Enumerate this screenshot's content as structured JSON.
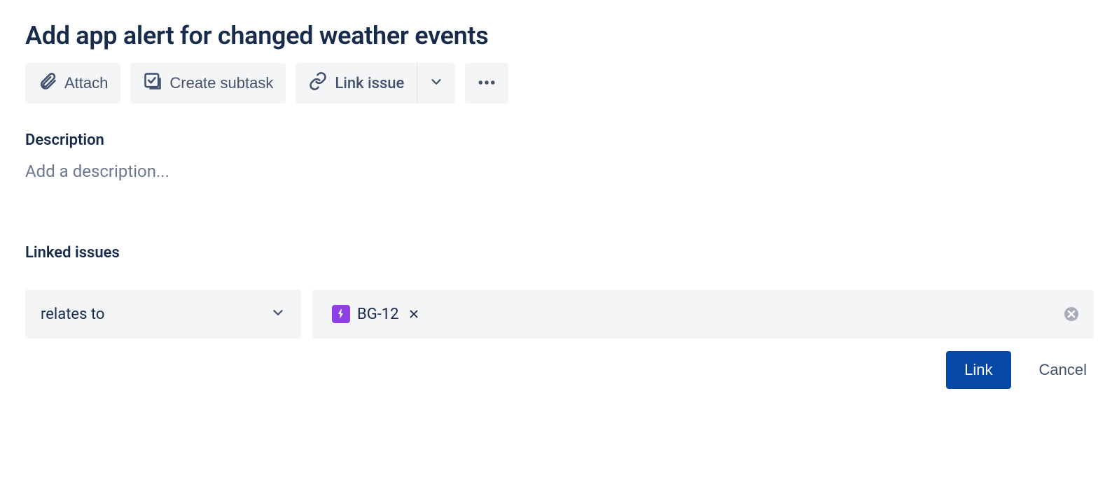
{
  "title": "Add app alert for changed weather events",
  "toolbar": {
    "attach_label": "Attach",
    "create_subtask_label": "Create subtask",
    "link_issue_label": "Link issue"
  },
  "sections": {
    "description_heading": "Description",
    "description_placeholder": "Add a description...",
    "linked_issues_heading": "Linked issues"
  },
  "link_form": {
    "relation_selected": "relates to",
    "selected_issue": {
      "key": "BG-12",
      "type_color": "#8F3FE6"
    },
    "link_button_label": "Link",
    "cancel_button_label": "Cancel"
  }
}
